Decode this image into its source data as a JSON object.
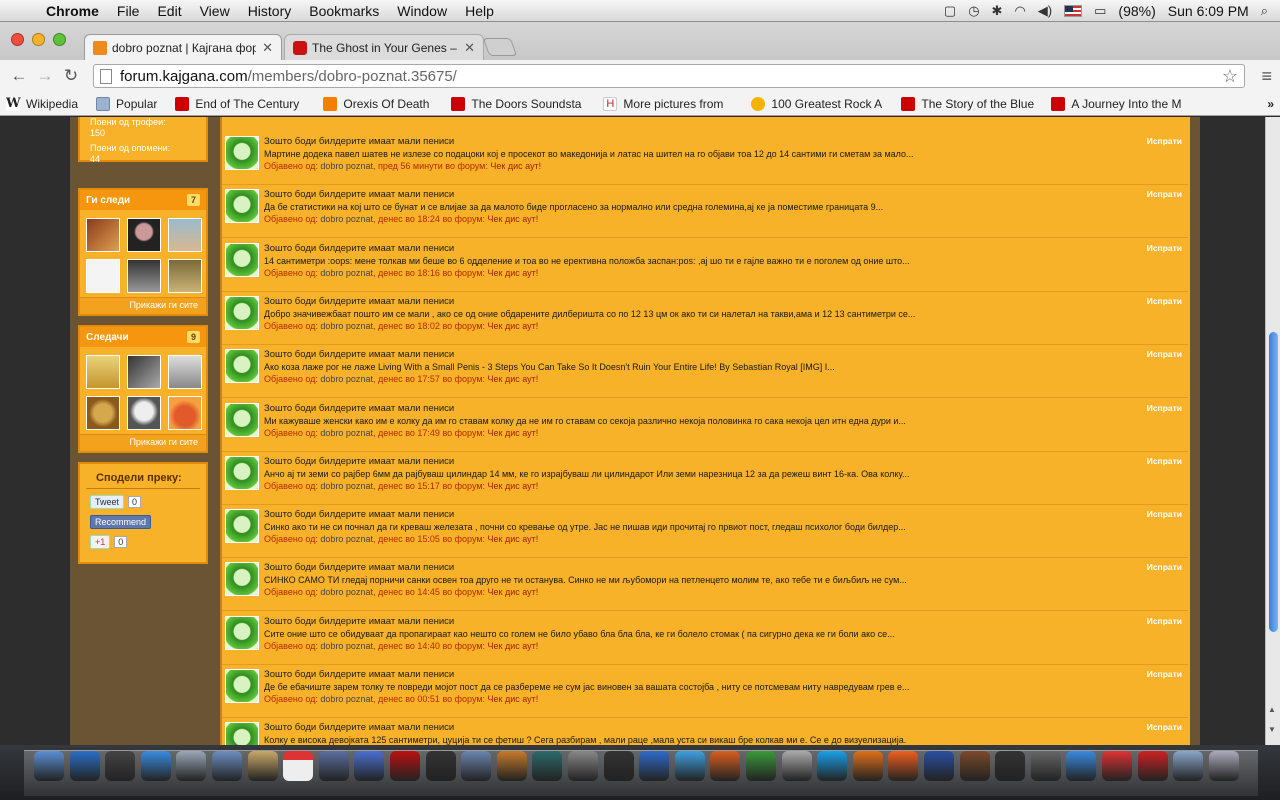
{
  "menubar": {
    "app": "Chrome",
    "menus": [
      "File",
      "Edit",
      "View",
      "History",
      "Bookmarks",
      "Window",
      "Help"
    ],
    "battery": "(98%)",
    "clock": "Sun 6:09 PM"
  },
  "tabs": [
    {
      "title": "dobro poznat | Кајгана фору",
      "color": "#f08a1c"
    },
    {
      "title": "The Ghost in Your Genes – B",
      "color": "#cc1111"
    }
  ],
  "address": {
    "host": "forum.kajgana.com",
    "path": "/members/dobro-poznat.35675/"
  },
  "bookmarks": [
    {
      "label": "Wikipedia",
      "icon": "wikipedia-icon",
      "color": "#fff"
    },
    {
      "label": "Popular",
      "icon": "folder-icon",
      "color": "#8ab"
    },
    {
      "label": "End of The Century",
      "icon": "youtube-icon",
      "color": "#c00"
    },
    {
      "label": "Orexis Of Death",
      "icon": "blogger-icon",
      "color": "#f57d00"
    },
    {
      "label": "The Doors Soundsta",
      "icon": "youtube-icon",
      "color": "#c00"
    },
    {
      "label": "More pictures from",
      "icon": "h-icon",
      "color": "#fff"
    },
    {
      "label": "100 Greatest Rock A",
      "icon": "p-icon",
      "color": "#f3b300"
    },
    {
      "label": "The Story of the Blue",
      "icon": "youtube-icon",
      "color": "#c00"
    },
    {
      "label": "A Journey Into the M",
      "icon": "youtube-icon",
      "color": "#c00"
    }
  ],
  "sidebar": {
    "points_label_1": "Поени од трофеи:",
    "points_value_1": "150",
    "points_label_2": "Поени од опомени:",
    "points_value_2": "44",
    "following": {
      "title": "Ги следи",
      "count": "7",
      "more": "Прикажи ги сите"
    },
    "followers": {
      "title": "Следачи",
      "count": "9",
      "more": "Прикажи ги сите"
    },
    "share": {
      "title": "Сподели преку:",
      "tweet": "Tweet",
      "tweet_count": "0",
      "recommend": "Recommend",
      "gplus": "+1",
      "gplus_count": "0"
    }
  },
  "feed": [
    {
      "title": "Зошто боди билдерите имаат мали пениси",
      "snippet": "Мартине додека павел шатев не излезе со подацоки кој е просекот во македонија и латас на шител на го објави тоа 12 до 14 сантими ги сметам за мало...",
      "author": "dobro poznat",
      "time": "пред 56 минути",
      "forum": "Чек дис аут!",
      "action": "Испрати"
    },
    {
      "title": "Зошто боди билдерите имаат мали пениси",
      "snippet": "Да бе статистики на кој што се бунат и се влијае за да малото биде прогласено за нормално или средна големина,ај ке ја поместиме границата 9...",
      "author": "dobro poznat",
      "time": "денес во 18:24",
      "forum": "Чек дис аут!",
      "action": "Испрати"
    },
    {
      "title": "Зошто боди билдерите имаат мали пениси",
      "snippet": "14 сантиметри :oops: мене толкав ми беше во 6 одделение и тоа во не ерективна положба заспан:pos: ,ај шо ти е гајле важно ти е поголем од оние што...",
      "author": "dobro poznat",
      "time": "денес во 18:16",
      "forum": "Чек дис аут!",
      "action": "Испрати"
    },
    {
      "title": "Зошто боди билдерите имаат мали пениси",
      "snippet": "Добро значивежбаат пошто им се мали , ако се од оние обдарените дилберишта со по 12 13 цм ок ако ти си налетал на такви,ама и 12 13 сантиметри се...",
      "author": "dobro poznat",
      "time": "денес во 18:02",
      "forum": "Чек дис аут!",
      "action": "Испрати"
    },
    {
      "title": "Зошто боди билдерите имаат мали пениси",
      "snippet": "Ако коза лаже рог не лаже Living With a Small Penis - 3 Steps You Can Take So It Doesn't Ruin Your Entire Life! By Sebastian Royal [IMG] I...",
      "author": "dobro poznat",
      "time": "денес во 17:57",
      "forum": "Чек дис аут!",
      "action": "Испрати"
    },
    {
      "title": "Зошто боди билдерите имаат мали пениси",
      "snippet": "Ми кажуваше женски како им е колку да им го ставам колку да не им го ставам со секоја различно некоја половинка го сака некоја цел итн една дури и...",
      "author": "dobro poznat",
      "time": "денес во 17:49",
      "forum": "Чек дис аут!",
      "action": "Испрати"
    },
    {
      "title": "Зошто боди билдерите имаат мали пениси",
      "snippet": "Анчо ај ти земи со рајбер 6мм да рајбуваш цилиндар 14 мм, ке го израјбуваш ли цилиндарот Или земи нарезница 12 за да режеш винт 16-ка. Ова колку...",
      "author": "dobro poznat",
      "time": "денес во 15:17",
      "forum": "Чек дис аут!",
      "action": "Испрати"
    },
    {
      "title": "Зошто боди билдерите имаат мали пениси",
      "snippet": "Синко ако ти не си почнал да ги креваш железата , почни со кревање од утре. Јас не пишав иди прочитај го првиот пост, гледаш психолог боди билдер...",
      "author": "dobro poznat",
      "time": "денес во 15:05",
      "forum": "Чек дис аут!",
      "action": "Испрати"
    },
    {
      "title": "Зошто боди билдерите имаат мали пениси",
      "snippet": "СИНКО САМО ТИ гледај порничи санки освен тоа друго не ти останува. Синко не ми љубомори на петленцето молим те, ако тебе ти е биљбиљ не сум...",
      "author": "dobro poznat",
      "time": "денес во 14:45",
      "forum": "Чек дис аут!",
      "action": "Испрати"
    },
    {
      "title": "Зошто боди билдерите имаат мали пениси",
      "snippet": "Сите оние што се обидуваат да пропагираат као нешто со голем не било убаво бла бла бла, ке ги болело стомак ( па сигурно дека ке ги боли ако се...",
      "author": "dobro poznat",
      "time": "денес во 14:40",
      "forum": "Чек дис аут!",
      "action": "Испрати"
    },
    {
      "title": "Зошто боди билдерите имаат мали пениси",
      "snippet": "Де бе ебачиште зарем толку те повреди мојот пост да се разбереме не сум јас виновен за вашата состојба , ниту се потсмевам ниту навредувам грев е...",
      "author": "dobro poznat",
      "time": "денес во 00:51",
      "forum": "Чек дис аут!",
      "action": "Испрати"
    },
    {
      "title": "Зошто боди билдерите имаат мали пениси",
      "snippet": "Колку е висока девојката 125 сантиметри, цуција ти се фетиш ? Сега разбирам , мали раце ,мала уста си викаш бре колкав ми е. Се е до визуелизација.",
      "author": "dobro poznat",
      "time": "",
      "forum": "",
      "action": "Испрати"
    }
  ],
  "labels": {
    "posted_by": "Објавено од:",
    "in_forum": "во форум:"
  }
}
